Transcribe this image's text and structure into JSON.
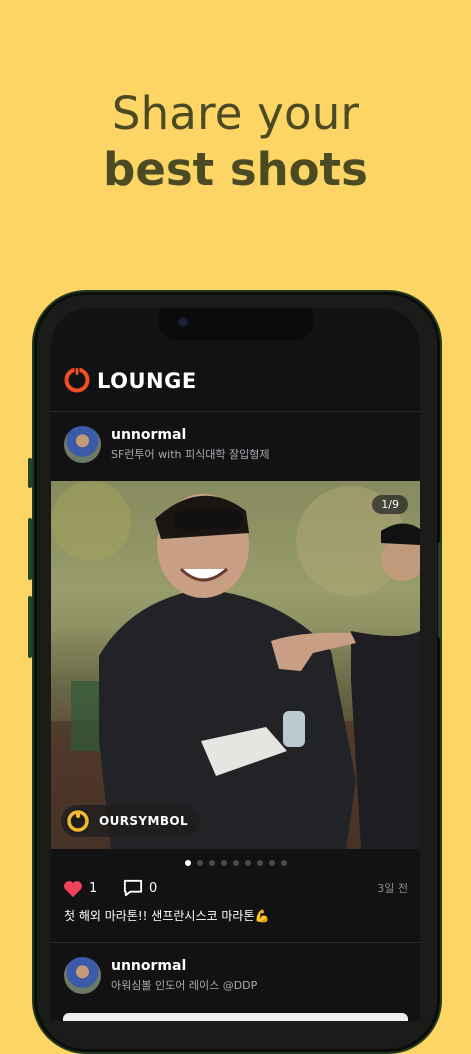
{
  "promo": {
    "line1": "Share your",
    "line2": "best shots"
  },
  "app": {
    "title": "LOUNGE",
    "accent": "#F04E23"
  },
  "posts": [
    {
      "username": "unnormal",
      "subtitle": "SF런투어 with 피식대학 잘입형제",
      "page_indicator": "1/9",
      "brand_name": "OURSYMBOL",
      "likes": "1",
      "comments": "0",
      "time": "3일 전",
      "caption": "첫 해외 마라톤!! 샌프란시스코 마라톤💪",
      "carousel_total": 9,
      "carousel_active": 1
    },
    {
      "username": "unnormal",
      "subtitle": "아워심볼 인도어 레이스 @DDP"
    }
  ],
  "icons": [
    "lounge-logo-icon",
    "heart-icon",
    "comment-icon",
    "brand-logo-icon"
  ],
  "colors": {
    "background": "#FDD564",
    "headline": "#4B4A23",
    "like": "#F2415A"
  }
}
